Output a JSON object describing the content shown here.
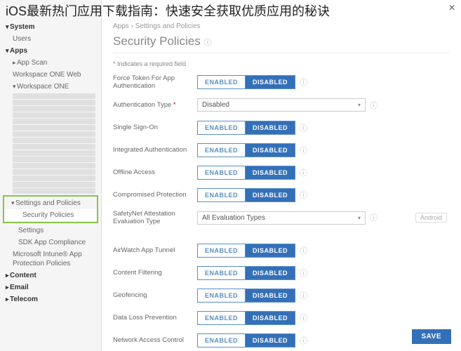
{
  "overlay": {
    "title": "iOS最新热门应用下载指南：快速安全获取优质应用的秘诀",
    "close": "✕"
  },
  "sidebar": {
    "groups": {
      "system": {
        "label": "System",
        "items": [
          "Users"
        ]
      },
      "apps": {
        "label": "Apps",
        "items": [
          {
            "label": "App Scan",
            "expanded": true
          },
          {
            "label": "Workspace ONE Web"
          },
          {
            "label": "Workspace ONE",
            "expanded": true
          }
        ],
        "settingsBox": {
          "parent": "Settings and Policies",
          "child": "Security Policies"
        },
        "after": [
          "Settings",
          "SDK App Compliance",
          "Microsoft Intune® App Protection Policies"
        ]
      },
      "content": {
        "label": "Content"
      },
      "email": {
        "label": "Email"
      },
      "telecom": {
        "label": "Telecom"
      }
    }
  },
  "breadcrumb": {
    "a": "Apps",
    "sep": "›",
    "b": "Settings and Policies"
  },
  "page": {
    "title": "Security Policies",
    "info": "ⓘ"
  },
  "requiredNote": "* Indicates a required field",
  "toggle": {
    "enabled": "ENABLED",
    "disabled": "DISABLED"
  },
  "rows": [
    {
      "key": "forceToken",
      "label": "Force Token For App Authentication",
      "type": "toggle",
      "value": "disabled",
      "required": false,
      "info": true
    },
    {
      "key": "authType",
      "label": "Authentication Type",
      "type": "select",
      "value": "Disabled",
      "required": true,
      "info": true
    },
    {
      "key": "sso",
      "label": "Single Sign-On",
      "type": "toggle",
      "value": "disabled",
      "info": true
    },
    {
      "key": "intAuth",
      "label": "Integrated Authentication",
      "type": "toggle",
      "value": "disabled",
      "info": true
    },
    {
      "key": "offline",
      "label": "Offline Access",
      "type": "toggle",
      "value": "disabled",
      "info": true
    },
    {
      "key": "compromised",
      "label": "Compromised Protection",
      "type": "toggle",
      "value": "disabled",
      "info": true
    },
    {
      "key": "safetynet",
      "label": "SafetyNet Attestation Evaluation Type",
      "type": "select",
      "value": "All Evaluation Types",
      "info": true,
      "tag": "Android"
    }
  ],
  "rows2": [
    {
      "key": "tunnel",
      "label": "AirWatch App Tunnel",
      "type": "toggle",
      "value": "disabled",
      "info": true
    },
    {
      "key": "contentFilter",
      "label": "Content Filtering",
      "type": "toggle",
      "value": "disabled",
      "info": true
    },
    {
      "key": "geofencing",
      "label": "Geofencing",
      "type": "toggle",
      "value": "disabled",
      "info": true
    },
    {
      "key": "dlp",
      "label": "Data Loss Prevention",
      "type": "toggle",
      "value": "disabled",
      "info": true
    },
    {
      "key": "nac",
      "label": "Network Access Control",
      "type": "toggle",
      "value": "disabled",
      "info": true
    }
  ],
  "save": "SAVE"
}
